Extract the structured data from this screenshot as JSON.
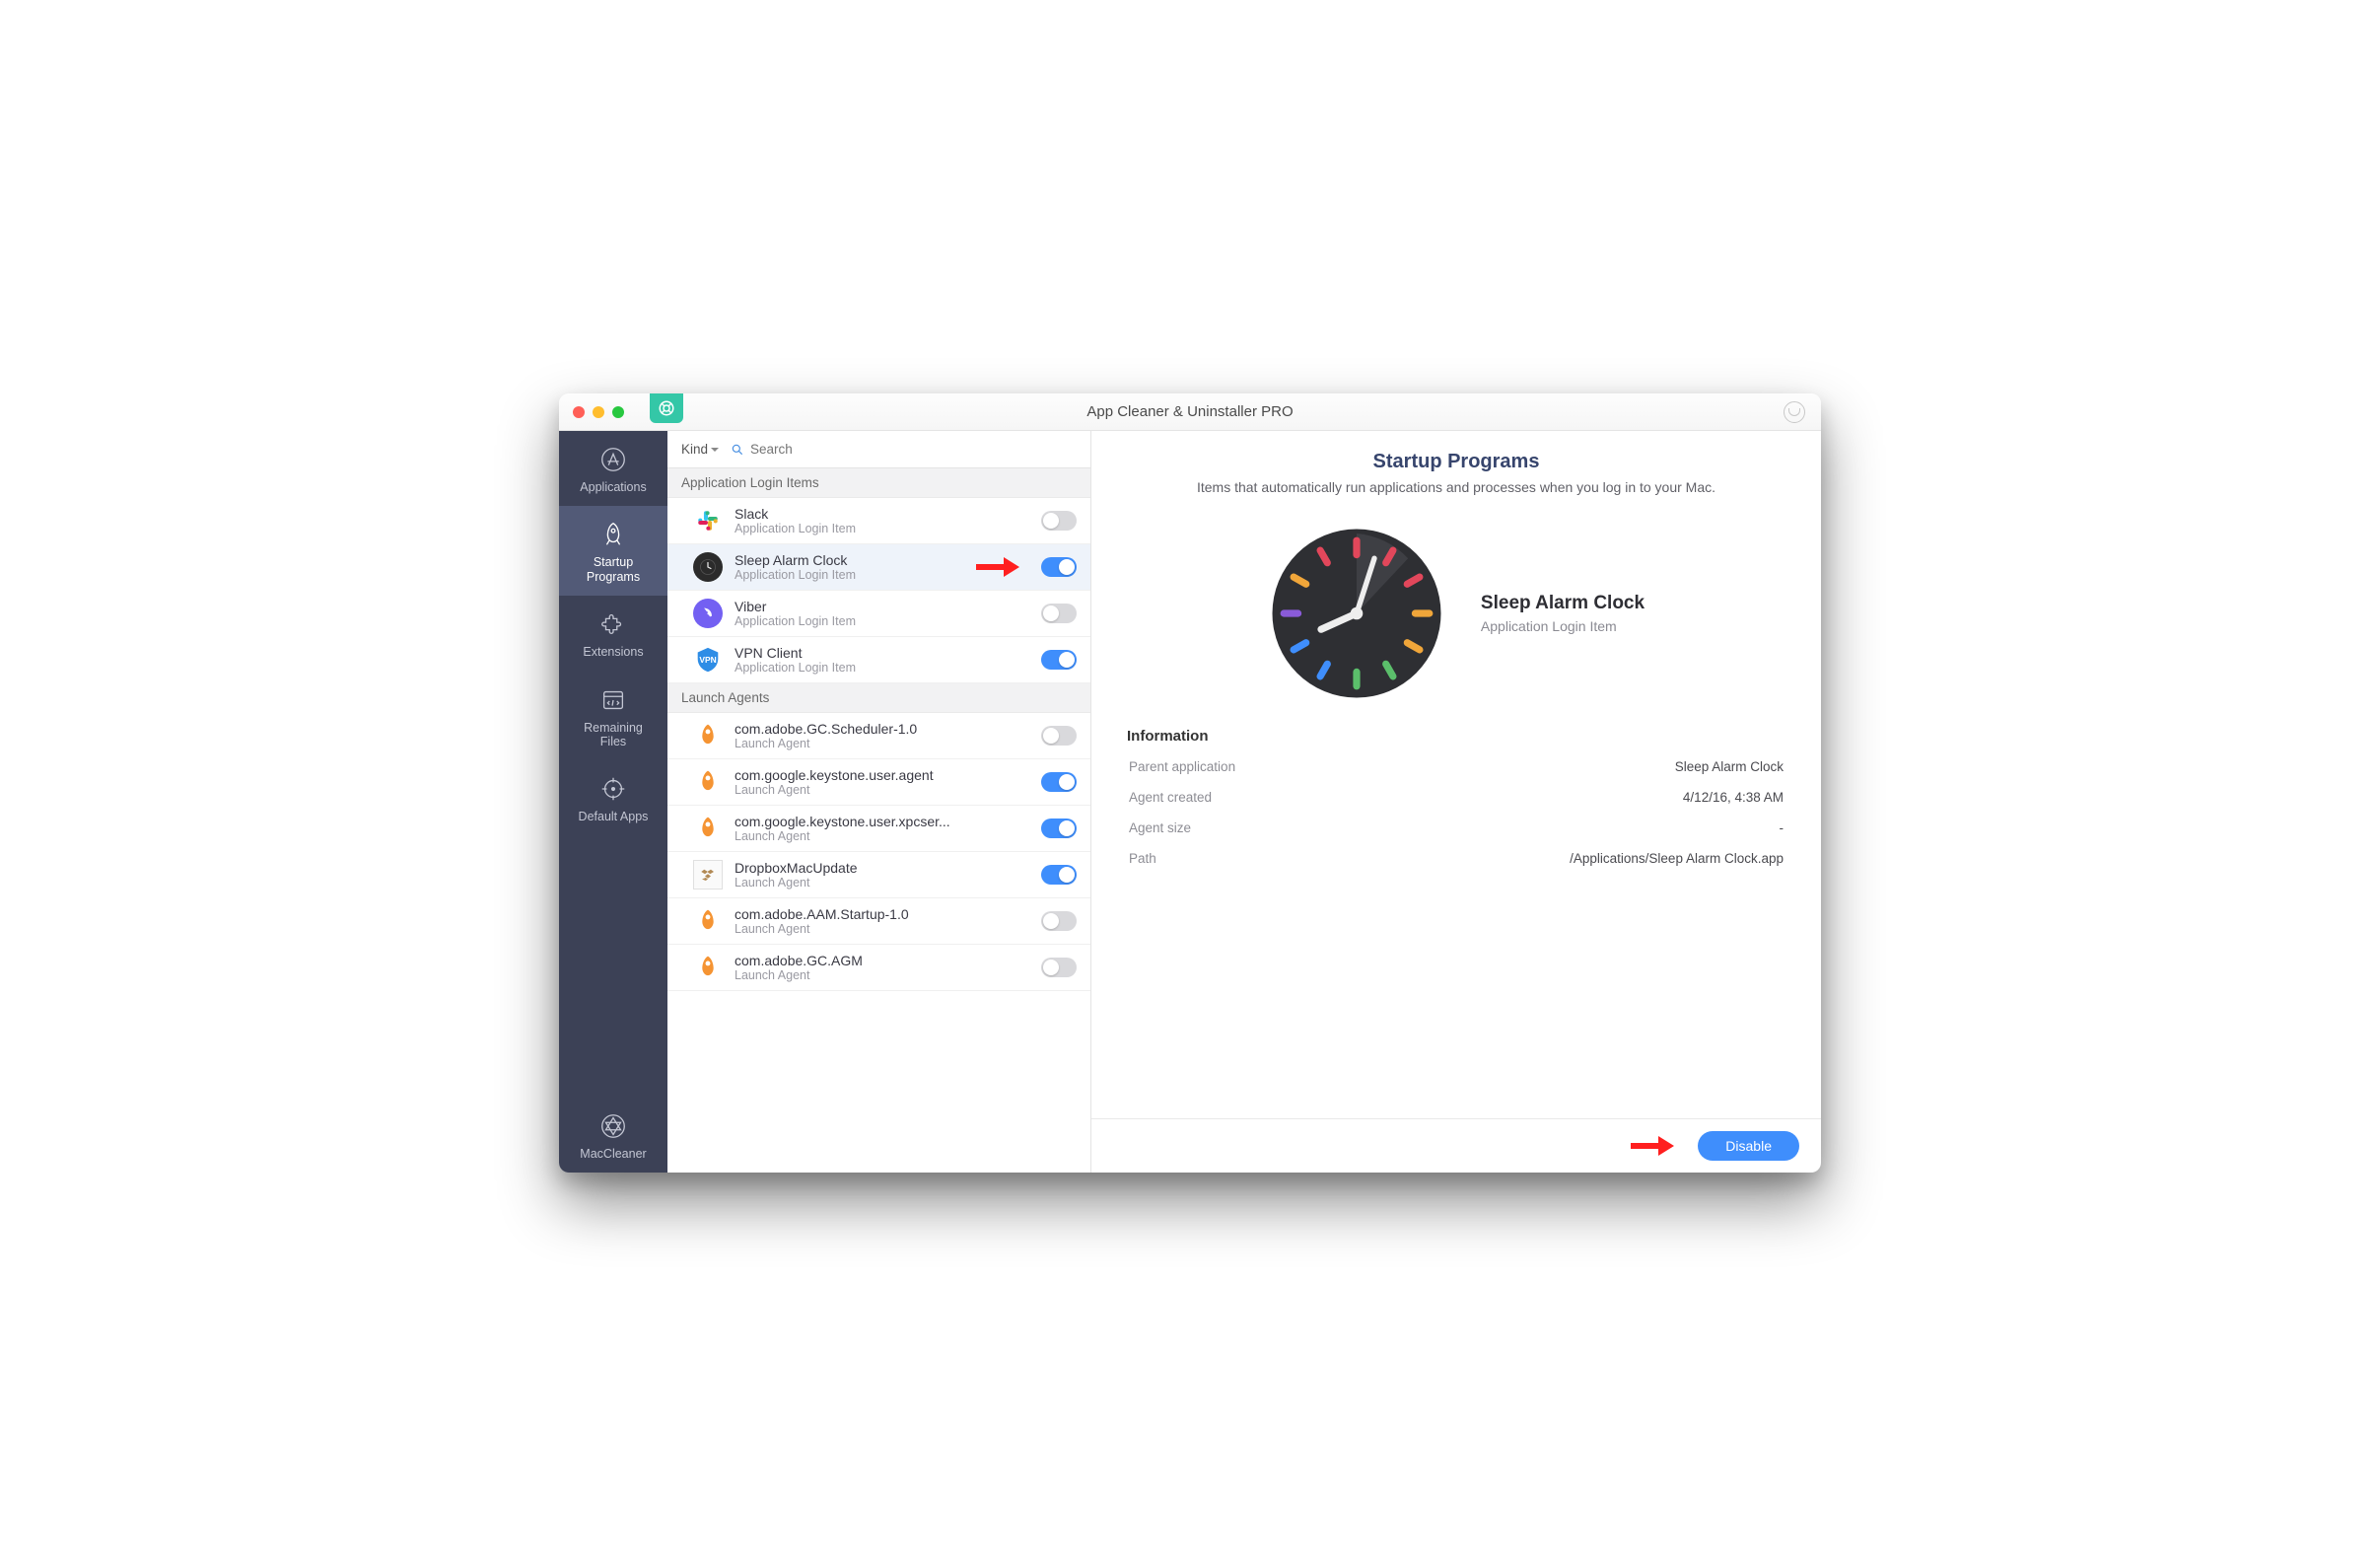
{
  "window": {
    "title": "App Cleaner & Uninstaller PRO"
  },
  "sidebar": {
    "items": [
      {
        "label": "Applications"
      },
      {
        "label": "Startup\nPrograms"
      },
      {
        "label": "Extensions"
      },
      {
        "label": "Remaining\nFiles"
      },
      {
        "label": "Default Apps"
      }
    ],
    "footer_label": "MacCleaner",
    "active_index": 1
  },
  "list_toolbar": {
    "sort_label": "Kind",
    "search_placeholder": "Search"
  },
  "sections": [
    {
      "title": "Application Login Items",
      "items": [
        {
          "name": "Slack",
          "subtitle": "Application Login Item",
          "icon": "slack",
          "enabled": false
        },
        {
          "name": "Sleep Alarm Clock",
          "subtitle": "Application Login Item",
          "icon": "clock",
          "enabled": true,
          "selected": true,
          "callout": true
        },
        {
          "name": "Viber",
          "subtitle": "Application Login Item",
          "icon": "viber",
          "enabled": false
        },
        {
          "name": "VPN Client",
          "subtitle": "Application Login Item",
          "icon": "vpn",
          "enabled": true
        }
      ]
    },
    {
      "title": "Launch Agents",
      "items": [
        {
          "name": "com.adobe.GC.Scheduler-1.0",
          "subtitle": "Launch Agent",
          "icon": "rocket",
          "enabled": false
        },
        {
          "name": "com.google.keystone.user.agent",
          "subtitle": "Launch Agent",
          "icon": "rocket",
          "enabled": true
        },
        {
          "name": "com.google.keystone.user.xpcser...",
          "subtitle": "Launch Agent",
          "icon": "rocket",
          "enabled": true
        },
        {
          "name": "DropboxMacUpdate",
          "subtitle": "Launch Agent",
          "icon": "dropbox",
          "enabled": true
        },
        {
          "name": "com.adobe.AAM.Startup-1.0",
          "subtitle": "Launch Agent",
          "icon": "rocket",
          "enabled": false
        },
        {
          "name": "com.adobe.GC.AGM",
          "subtitle": "Launch Agent",
          "icon": "rocket",
          "enabled": false
        }
      ]
    }
  ],
  "detail": {
    "title": "Startup Programs",
    "description": "Items that automatically run applications and processes when you log in to your Mac.",
    "hero": {
      "name": "Sleep Alarm Clock",
      "subtitle": "Application Login Item"
    },
    "info_heading": "Information",
    "info_rows": [
      {
        "key": "Parent application",
        "value": "Sleep Alarm Clock"
      },
      {
        "key": "Agent created",
        "value": "4/12/16, 4:38 AM"
      },
      {
        "key": "Agent size",
        "value": "-"
      },
      {
        "key": "Path",
        "value": "/Applications/Sleep Alarm Clock.app"
      }
    ],
    "primary_button": "Disable"
  }
}
